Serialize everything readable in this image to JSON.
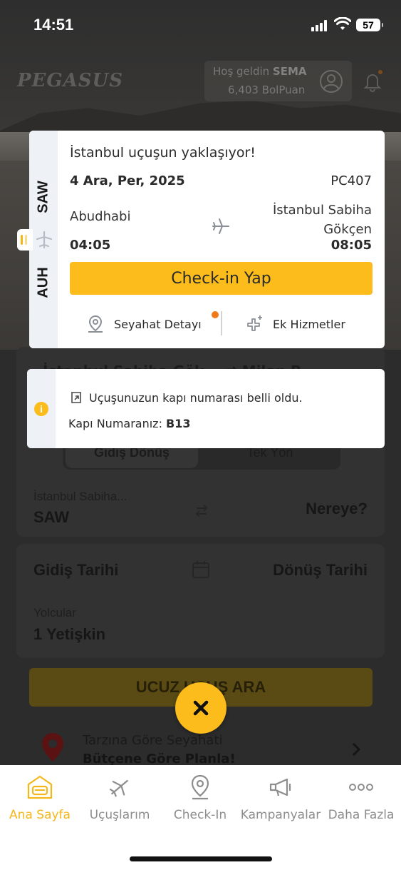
{
  "status_bar": {
    "time": "14:51",
    "battery": "57"
  },
  "header": {
    "logo": "PEGASUS",
    "welcome_prefix": "Hoş geldin ",
    "welcome_name": "SEMA",
    "points": "6,403 BolPuan"
  },
  "flight_card": {
    "title": "İstanbul uçuşun yaklaşıyor!",
    "date": "4 Ara, Per, 2025",
    "flight_number": "PC407",
    "origin_code": "AUH",
    "destination_code": "SAW",
    "origin_city": "Abudhabi",
    "destination_city": "İstanbul Sabiha Gökçen",
    "departure_time": "04:05",
    "arrival_time": "08:05",
    "checkin_label": "Check-in Yap",
    "travel_details_label": "Seyahat Detayı",
    "extra_services_label": "Ek Hizmetler"
  },
  "notice": {
    "message": "Uçuşunuzun kapı numarası belli oldu.",
    "gate_label": "Kapı Numaranız: ",
    "gate_value": "B13"
  },
  "booking_form": {
    "route_peek": "İstanbul Sabiha Gök... ⇄ Milan B...",
    "trip_type_round": "Gidiş Dönüş",
    "trip_type_oneway": "Tek Yön",
    "from_city": "İstanbul Sabiha...",
    "from_code": "SAW",
    "to_placeholder": "Nereye?",
    "departure_date_label": "Gidiş Tarihi",
    "return_date_label": "Dönüş Tarihi",
    "passengers_label": "Yolcular",
    "passengers_value": "1 Yetişkin",
    "search_button": "UCUZ UÇUŞ ARA"
  },
  "promo": {
    "line1": "Tarzına Göre Seyahati",
    "line2": "Bütçene Göre Planla!"
  },
  "tabs": [
    {
      "label": "Ana Sayfa",
      "icon": "home-icon",
      "active": true
    },
    {
      "label": "Uçuşlarım",
      "icon": "plane-icon",
      "active": false
    },
    {
      "label": "Check-In",
      "icon": "location-pin-icon",
      "active": false
    },
    {
      "label": "Kampanyalar",
      "icon": "megaphone-icon",
      "active": false
    },
    {
      "label": "Daha Fazla",
      "icon": "more-icon",
      "active": false
    }
  ],
  "colors": {
    "accent": "#fbbc1c",
    "active_tab": "#f4b71a",
    "badge": "#f07a18",
    "rail": "#eef1f6"
  }
}
